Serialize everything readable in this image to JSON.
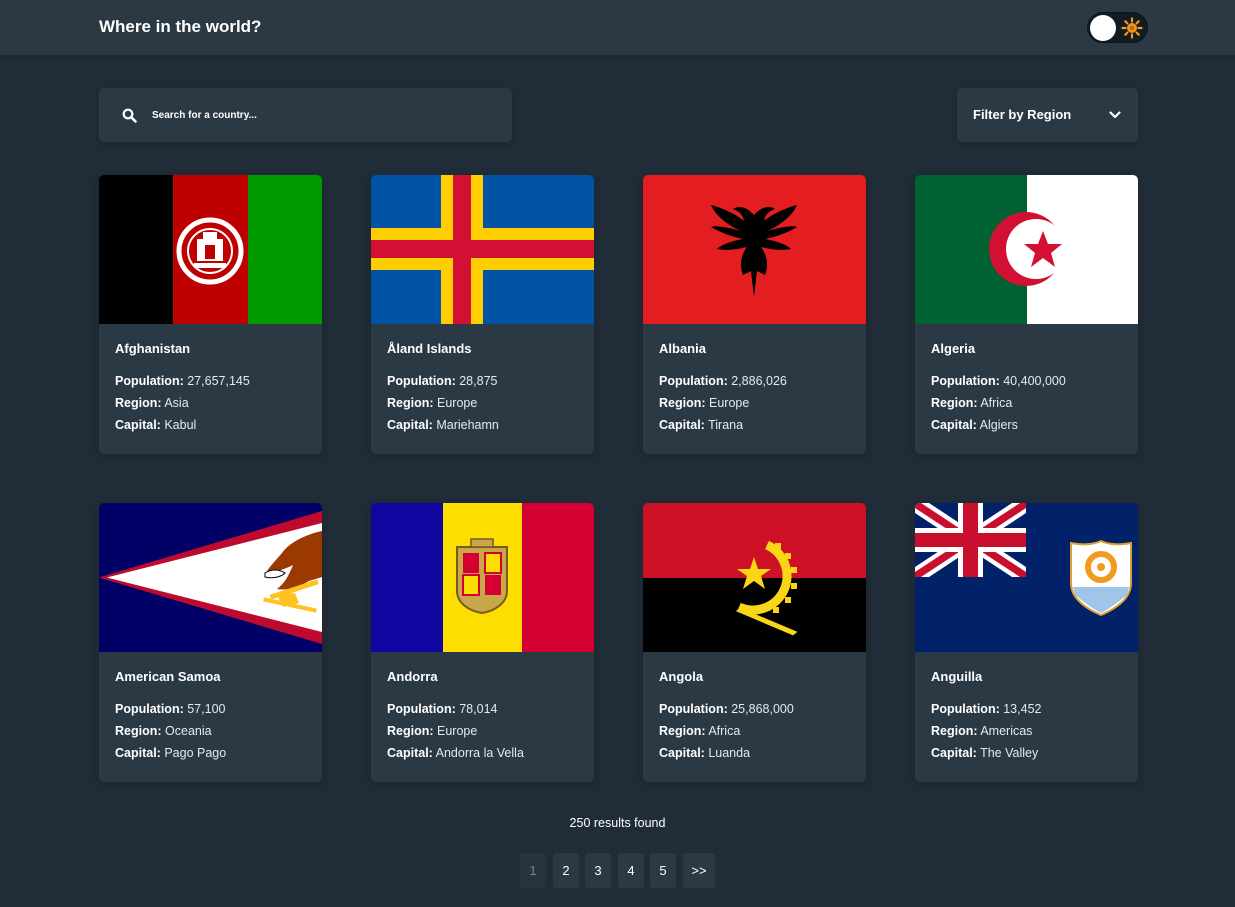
{
  "header": {
    "title": "Where in the world?"
  },
  "search": {
    "placeholder": "Search for a country..."
  },
  "filter": {
    "label": "Filter by Region"
  },
  "labels": {
    "population": "Population:",
    "region": "Region:",
    "capital": "Capital:"
  },
  "countries": [
    {
      "name": "Afghanistan",
      "population": "27,657,145",
      "region": "Asia",
      "capital": "Kabul"
    },
    {
      "name": "Åland Islands",
      "population": "28,875",
      "region": "Europe",
      "capital": "Mariehamn"
    },
    {
      "name": "Albania",
      "population": "2,886,026",
      "region": "Europe",
      "capital": "Tirana"
    },
    {
      "name": "Algeria",
      "population": "40,400,000",
      "region": "Africa",
      "capital": "Algiers"
    },
    {
      "name": "American Samoa",
      "population": "57,100",
      "region": "Oceania",
      "capital": "Pago Pago"
    },
    {
      "name": "Andorra",
      "population": "78,014",
      "region": "Europe",
      "capital": "Andorra la Vella"
    },
    {
      "name": "Angola",
      "population": "25,868,000",
      "region": "Africa",
      "capital": "Luanda"
    },
    {
      "name": "Anguilla",
      "population": "13,452",
      "region": "Americas",
      "capital": "The Valley"
    }
  ],
  "results": {
    "text": "250 results found"
  },
  "pagination": {
    "pages": [
      "1",
      "2",
      "3",
      "4",
      "5"
    ],
    "next": ">>",
    "current": "1"
  },
  "colors": {
    "background": "#202c37",
    "element": "#2b3945",
    "text": "#ffffff"
  }
}
